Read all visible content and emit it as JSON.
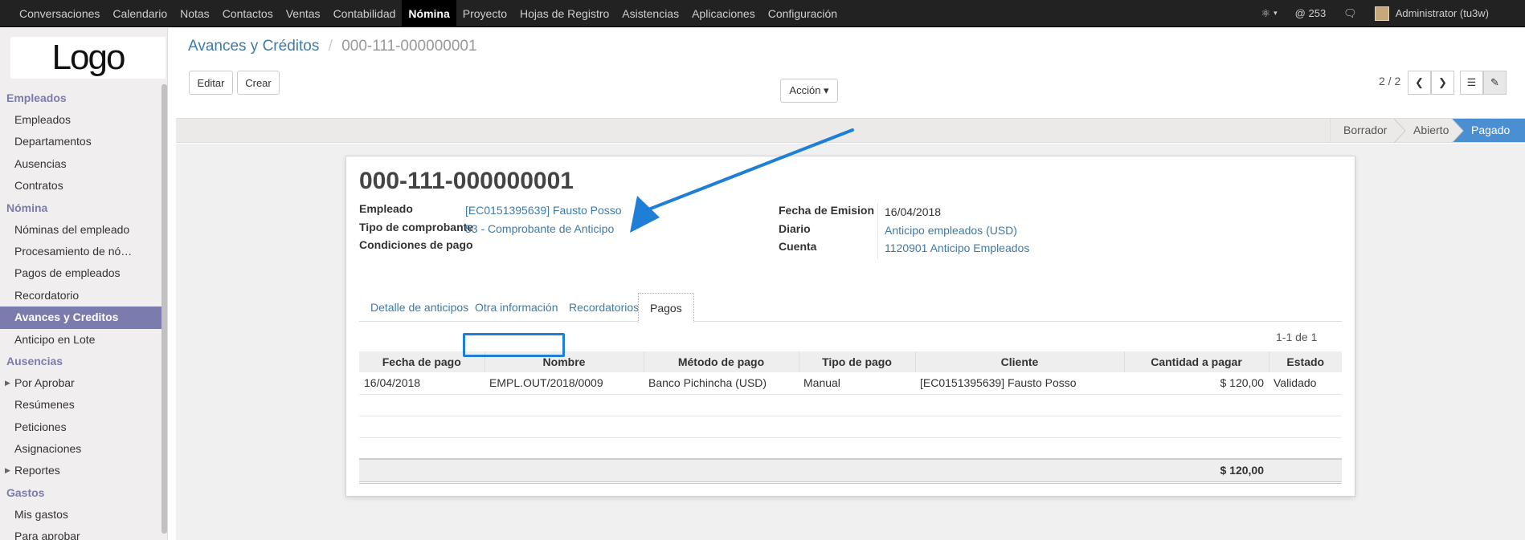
{
  "topbar": {
    "menu": [
      "Conversaciones",
      "Calendario",
      "Notas",
      "Contactos",
      "Ventas",
      "Contabilidad",
      "Nómina",
      "Proyecto",
      "Hojas de Registro",
      "Asistencias",
      "Aplicaciones",
      "Configuración"
    ],
    "active": "Nómina",
    "bug_icon": "bug-icon",
    "mentions": "@ 253",
    "chat_icon": "chat-icon",
    "user": "Administrator (tu3w)"
  },
  "sidebar": {
    "logo": "Logo",
    "sections": [
      {
        "title": "Empleados",
        "items": [
          "Empleados",
          "Departamentos",
          "Ausencias",
          "Contratos"
        ]
      },
      {
        "title": "Nómina",
        "items": [
          "Nóminas del empleado",
          "Procesamiento de nó…",
          "Pagos de empleados",
          "Recordatorio",
          "Avances y Creditos",
          "Anticipo en Lote"
        ]
      },
      {
        "title": "Ausencias",
        "items": [
          "Por Aprobar",
          "Resúmenes",
          "Peticiones",
          "Asignaciones",
          "Reportes"
        ]
      },
      {
        "title": "Gastos",
        "items": [
          "Mis gastos",
          "Para aprobar"
        ]
      }
    ],
    "active_item": "Avances y Creditos"
  },
  "breadcrumb": {
    "parent": "Avances y Créditos",
    "separator": "/",
    "current": "000-111-000000001"
  },
  "toolbar": {
    "edit": "Editar",
    "create": "Crear",
    "action": "Acción ▾",
    "pager": "2 / 2"
  },
  "statusbar": {
    "stages": [
      "Borrador",
      "Abierto",
      "Pagado"
    ],
    "current": "Pagado"
  },
  "record": {
    "title": "000-111-000000001",
    "left_fields": [
      {
        "label": "Empleado",
        "value": "[EC0151395639] Fausto Posso"
      },
      {
        "label": "Tipo de comprobante",
        "value": "53 - Comprobante de Anticipo"
      },
      {
        "label": "Condiciones de pago",
        "value": ""
      }
    ],
    "right_fields": [
      {
        "label": "Fecha de Emision",
        "value": "16/04/2018"
      },
      {
        "label": "Diario",
        "value": "Anticipo empleados (USD)"
      },
      {
        "label": "Cuenta",
        "value": "1120901 Anticipo Empleados"
      }
    ]
  },
  "tabs": [
    "Detalle de anticipos",
    "Otra información",
    "Recordatorios",
    "Pagos"
  ],
  "active_tab": "Pagos",
  "payments": {
    "count": "1-1 de 1",
    "columns": [
      "Fecha de pago",
      "Nombre",
      "Método de pago",
      "Tipo de pago",
      "Cliente",
      "Cantidad a pagar",
      "Estado"
    ],
    "rows": [
      [
        "16/04/2018",
        "EMPL.OUT/2018/0009",
        "Banco Pichincha (USD)",
        "Manual",
        "[EC0151395639] Fausto Posso",
        "$ 120,00",
        "Validado"
      ]
    ],
    "total": "$ 120,00"
  },
  "colors": {
    "accent": "#7c7bad",
    "link": "#3e7aa7",
    "status_current": "#4a8fd1",
    "annotation": "#1f7fd6"
  }
}
